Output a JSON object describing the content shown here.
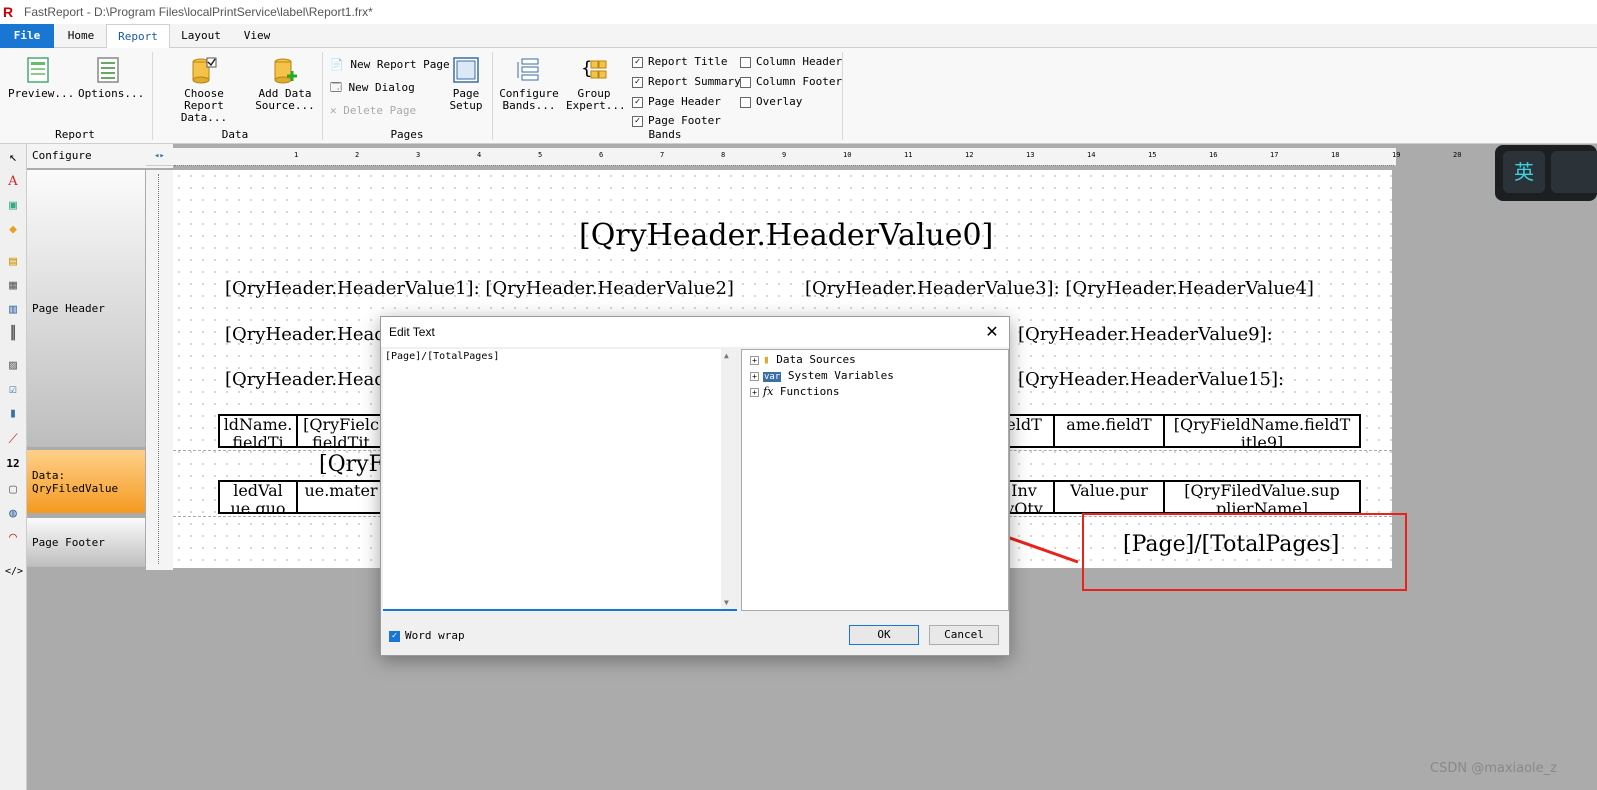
{
  "window": {
    "logo": "R",
    "title": "FastReport - D:\\Program Files\\localPrintService\\label\\Report1.frx*"
  },
  "tabs": [
    {
      "label": "File"
    },
    {
      "label": "Home"
    },
    {
      "label": "Report"
    },
    {
      "label": "Layout"
    },
    {
      "label": "View"
    }
  ],
  "ribbon": {
    "report": {
      "preview": "Preview...",
      "options": "Options...",
      "group": "Report"
    },
    "data": {
      "choose_data": "Choose Report Data...",
      "add_source": "Add Data Source...",
      "group": "Data"
    },
    "pages": {
      "new_page": "New Report Page",
      "new_dialog": "New Dialog",
      "delete_page": "Delete Page",
      "page_setup": "Page Setup",
      "group": "Pages"
    },
    "bands": {
      "configure": "Configure Bands...",
      "group_expert": "Group Expert...",
      "group": "Bands",
      "report_title": "Report Title",
      "report_summary": "Report Summary",
      "page_header": "Page Header",
      "page_footer": "Page Footer",
      "column_header": "Column Header",
      "column_footer": "Column Footer",
      "overlay": "Overlay",
      "checks": {
        "report_title": true,
        "report_summary": true,
        "page_header": true,
        "page_footer": true,
        "column_header": false,
        "column_footer": false,
        "overlay": false
      }
    }
  },
  "bands_panel": {
    "configure": "Configure",
    "page_header": "Page Header",
    "data": "Data: QryFiledValue",
    "page_footer": "Page Footer"
  },
  "ruler": {
    "ticks": [
      "1",
      "2",
      "3",
      "4",
      "5",
      "6",
      "7",
      "8",
      "9",
      "10",
      "11",
      "12",
      "13",
      "14",
      "15",
      "16",
      "17",
      "18",
      "19",
      "20"
    ]
  },
  "design": {
    "header0": "[QryHeader.HeaderValue0]",
    "row1_left": "[QryHeader.HeaderValue1]: [QryHeader.HeaderValue2]",
    "row1_right": "[QryHeader.HeaderValue3]: [QryHeader.HeaderValue4]",
    "row2_left": "[QryHeader.Heade",
    "row2_right": "[QryHeader.HeaderValue9]:",
    "row3_left": "[QryHeader.Heade",
    "row3_right": "[QryHeader.HeaderValue15]:",
    "col_cells": [
      "ldName.\nfieldTi",
      "[QryFielc\nfieldTit",
      "eldT\n",
      "ame.fieldT\n",
      "[QryFieldName.fieldT\nitle9]"
    ],
    "data_group": "[QryF",
    "data_cells": [
      "ledVal\nue.quo",
      "ue.mater",
      "Inv\nyQty",
      "Value.pur",
      "[QryFiledValue.sup\nplierName]"
    ],
    "footer": "[Page]/[TotalPages]"
  },
  "ime": {
    "label": "英"
  },
  "dialog": {
    "title": "Edit Text",
    "text": "[Page]/[TotalPages]",
    "tree": [
      "Data Sources",
      "System Variables",
      "Functions"
    ],
    "tree_icons": [
      "database-icon",
      "var-icon",
      "fx-icon"
    ],
    "var_badge": "var",
    "fx_badge": "fx",
    "word_wrap": "Word wrap",
    "word_wrap_checked": true,
    "ok": "OK",
    "cancel": "Cancel"
  },
  "annotation_color": "#e8231d",
  "watermark": "CSDN @maxiaole_z"
}
